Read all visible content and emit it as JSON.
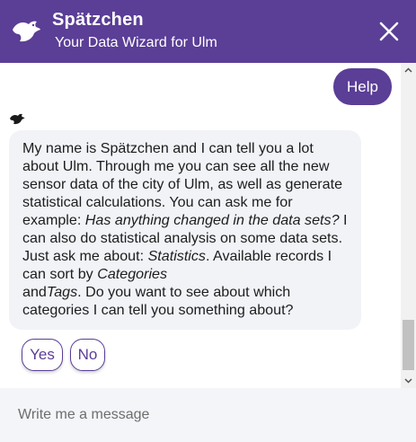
{
  "header": {
    "title": "Spätzchen",
    "subtitle": "Your Data Wizard for Ulm",
    "logo_icon": "bird-icon",
    "close_icon": "close-icon"
  },
  "messages": {
    "user": "Help",
    "bot": {
      "p1": "My name is Spätzchen and I can tell you a lot about Ulm. Through me you can see all the new sensor data of the city of Ulm, as well as generate statistical calculations. You can ask me for example: ",
      "example_question": "Has anything changed in the data sets?",
      "p2": " I can also do statistical analysis on some data sets. Just ask me about: ",
      "statistics": "Statistics",
      "p3": ". Available records I can sort by ",
      "categories": "Categories",
      "p4": " and",
      "tags": "Tags",
      "p5": ". Do you want to see about which categories I can tell you something about?"
    }
  },
  "quick_replies": [
    "Yes",
    "No"
  ],
  "input": {
    "placeholder": "Write me a message"
  },
  "colors": {
    "brand": "#5b3e96",
    "bot_bubble": "#f1f3f7",
    "input_bg": "#f3f5f8"
  }
}
